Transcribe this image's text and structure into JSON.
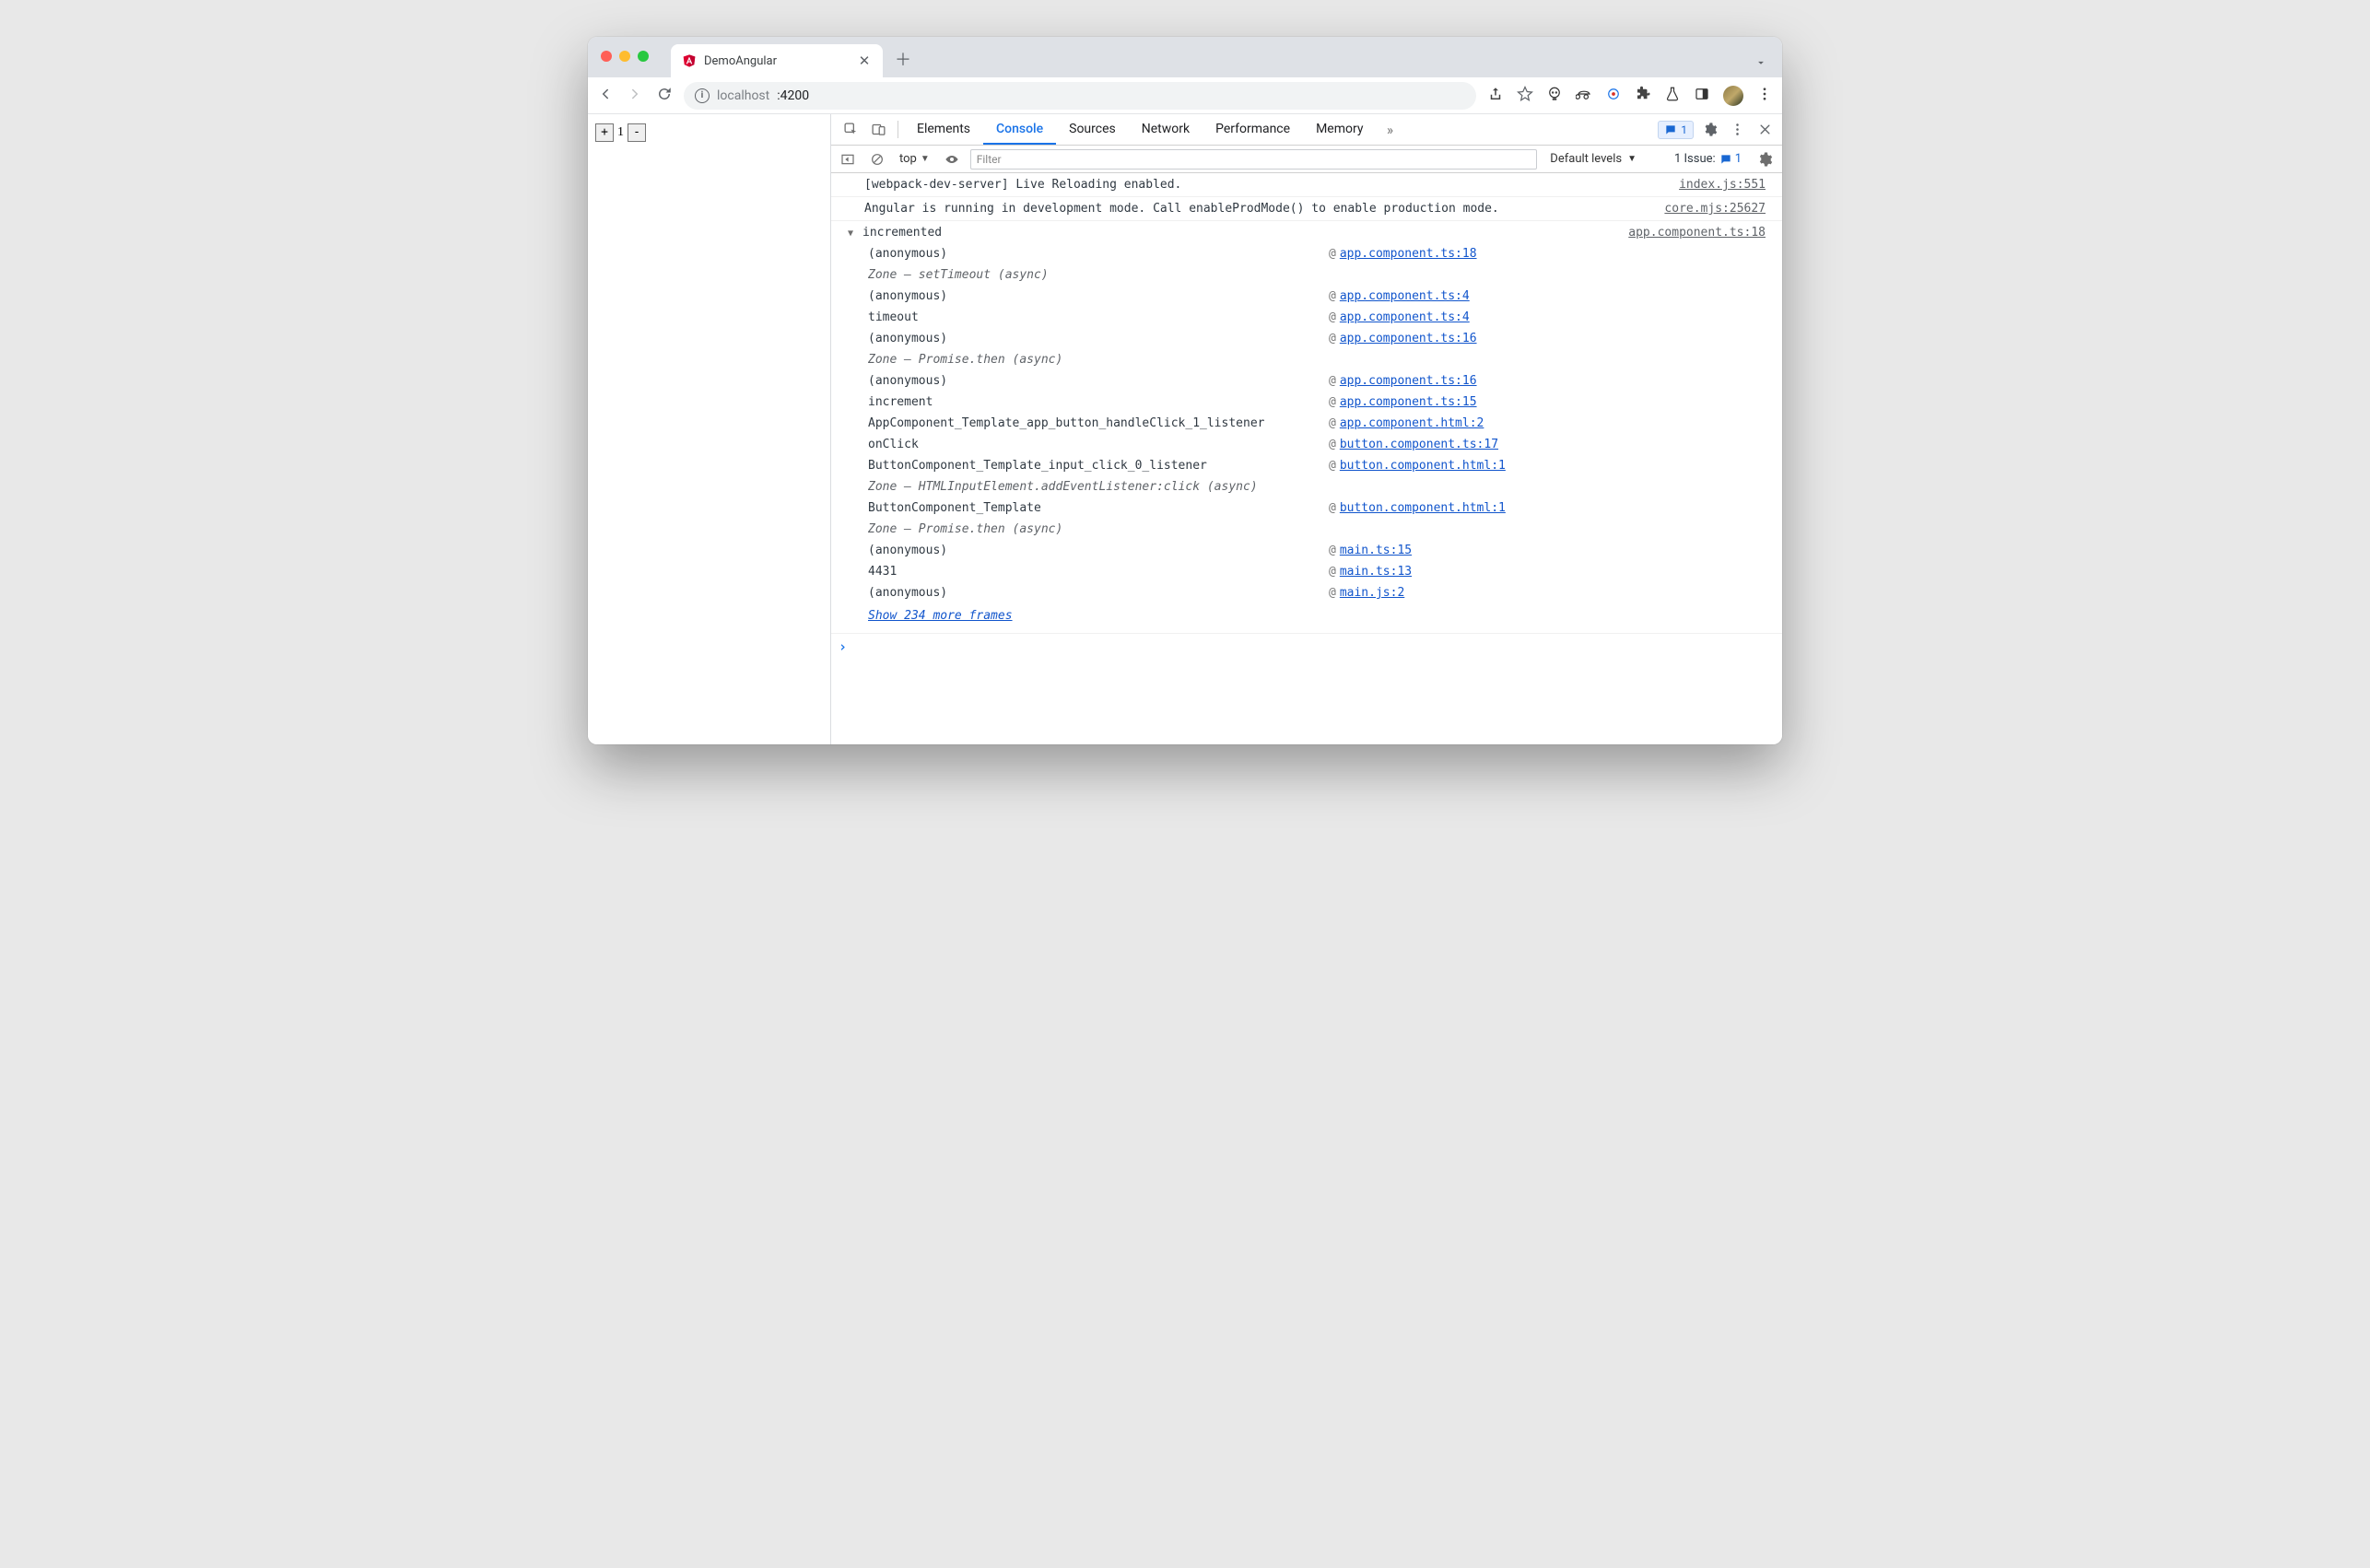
{
  "browser": {
    "tab_title": "DemoAngular",
    "url_host": "localhost",
    "url_path": ":4200"
  },
  "page": {
    "counter_value": "1",
    "plus_label": "+",
    "minus_label": "-"
  },
  "devtools": {
    "tabs": {
      "elements": "Elements",
      "console": "Console",
      "sources": "Sources",
      "network": "Network",
      "performance": "Performance",
      "memory": "Memory"
    },
    "messages_badge": "1",
    "toolbar": {
      "context": "top",
      "filter_placeholder": "Filter",
      "levels": "Default levels",
      "issues_label": "1 Issue:",
      "issues_count": "1"
    },
    "logs": {
      "row1_text": "[webpack-dev-server] Live Reloading enabled.",
      "row1_src": "index.js:551",
      "row2_text": "Angular is running in development mode. Call enableProdMode() to enable production mode.",
      "row2_src": "core.mjs:25627"
    },
    "trace": {
      "message": "incremented",
      "origin": "app.component.ts:18",
      "frames": [
        {
          "fn": "(anonymous)",
          "loc": "app.component.ts:18",
          "zone": false
        },
        {
          "fn": "Zone — setTimeout (async)",
          "zone": true
        },
        {
          "fn": "(anonymous)",
          "loc": "app.component.ts:4",
          "zone": false
        },
        {
          "fn": "timeout",
          "loc": "app.component.ts:4",
          "zone": false
        },
        {
          "fn": "(anonymous)",
          "loc": "app.component.ts:16",
          "zone": false
        },
        {
          "fn": "Zone — Promise.then (async)",
          "zone": true
        },
        {
          "fn": "(anonymous)",
          "loc": "app.component.ts:16",
          "zone": false
        },
        {
          "fn": "increment",
          "loc": "app.component.ts:15",
          "zone": false
        },
        {
          "fn": "AppComponent_Template_app_button_handleClick_1_listener",
          "loc": "app.component.html:2",
          "zone": false
        },
        {
          "fn": "onClick",
          "loc": "button.component.ts:17",
          "zone": false
        },
        {
          "fn": "ButtonComponent_Template_input_click_0_listener",
          "loc": "button.component.html:1",
          "zone": false
        },
        {
          "fn": "Zone — HTMLInputElement.addEventListener:click (async)",
          "zone": true
        },
        {
          "fn": "ButtonComponent_Template",
          "loc": "button.component.html:1",
          "zone": false
        },
        {
          "fn": "Zone — Promise.then (async)",
          "zone": true
        },
        {
          "fn": "(anonymous)",
          "loc": "main.ts:15",
          "zone": false
        },
        {
          "fn": "4431",
          "loc": "main.ts:13",
          "zone": false
        },
        {
          "fn": "(anonymous)",
          "loc": "main.js:2",
          "zone": false
        }
      ],
      "more_frames": "Show 234 more frames"
    }
  }
}
